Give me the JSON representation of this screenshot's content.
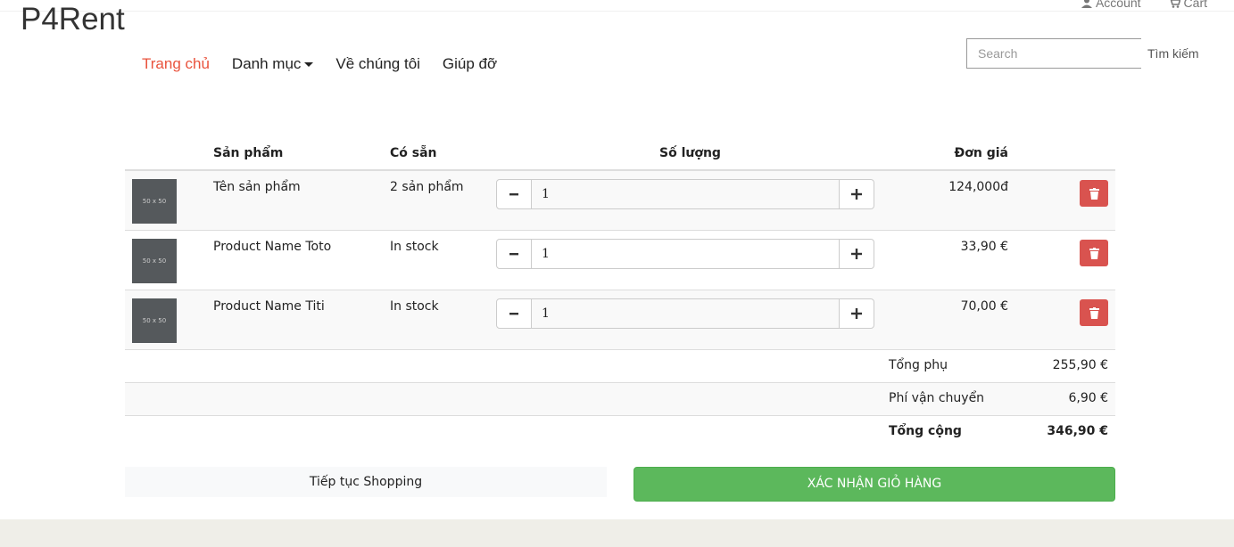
{
  "brand": "P4Rent",
  "topnav": {
    "account": "Account",
    "cart": "Cart"
  },
  "nav": [
    {
      "label": "Trang chủ"
    },
    {
      "label": "Danh mục"
    },
    {
      "label": "Về chúng tôi"
    },
    {
      "label": "Giúp đỡ"
    }
  ],
  "search": {
    "placeholder": "Search",
    "button": "Tìm kiếm"
  },
  "table": {
    "headers": {
      "product": "Sản phẩm",
      "available": "Có sẵn",
      "quantity": "Số lượng",
      "unit_price": "Đơn giá"
    },
    "rows": [
      {
        "thumb": "50 x 50",
        "name": "Tên sản phẩm",
        "available": "2 sản phẩm",
        "qty": "1",
        "price": "124,000đ"
      },
      {
        "thumb": "50 x 50",
        "name": "Product Name Toto",
        "available": "In stock",
        "qty": "1",
        "price": "33,90 €"
      },
      {
        "thumb": "50 x 50",
        "name": "Product Name Titi",
        "available": "In stock",
        "qty": "1",
        "price": "70,00 €"
      }
    ]
  },
  "summary": {
    "subtotal_label": "Tổng phụ",
    "subtotal": "255,90 €",
    "shipping_label": "Phí vận chuyển",
    "shipping": "6,90 €",
    "total_label": "Tổng cộng",
    "total": "346,90 €"
  },
  "actions": {
    "continue": "Tiếp tục Shopping",
    "confirm": "XÁC NHẬN GIỎ HÀNG"
  },
  "colors": {
    "accent": "#e9533d",
    "confirm": "#5cb85c",
    "delete": "#d9534f"
  }
}
